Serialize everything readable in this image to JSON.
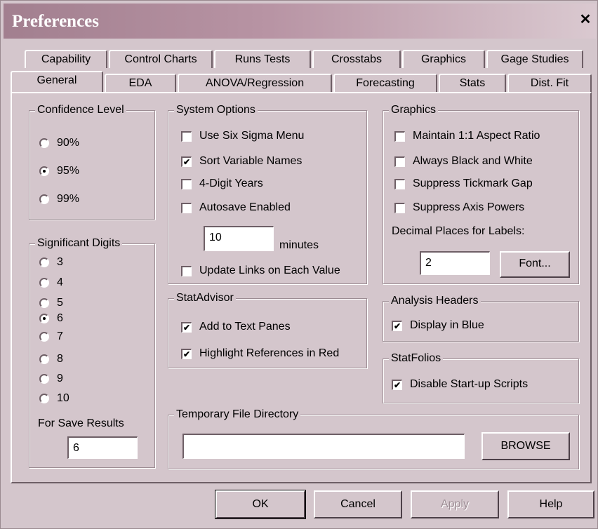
{
  "window": {
    "title": "Preferences"
  },
  "tabs": {
    "row1": [
      "Capability",
      "Control Charts",
      "Runs Tests",
      "Crosstabs",
      "Graphics",
      "Gage Studies"
    ],
    "row2": [
      "General",
      "EDA",
      "ANOVA/Regression",
      "Forecasting",
      "Stats",
      "Dist. Fit"
    ],
    "active": "General"
  },
  "confidence": {
    "title": "Confidence Level",
    "options": [
      "90%",
      "95%",
      "99%"
    ],
    "selected": "95%"
  },
  "significant": {
    "title": "Significant Digits",
    "options": [
      "3",
      "4",
      "5",
      "6",
      "7",
      "8",
      "9",
      "10"
    ],
    "selected": "6",
    "save_label": "For Save Results",
    "save_value": "6"
  },
  "system": {
    "title": "System Options",
    "six_sigma": "Use Six Sigma Menu",
    "sort_vars": "Sort Variable Names",
    "four_digit": "4-Digit Years",
    "autosave": "Autosave Enabled",
    "minutes_value": "10",
    "minutes_label": "minutes",
    "update_links": "Update Links on Each Value"
  },
  "graphics": {
    "title": "Graphics",
    "aspect": "Maintain 1:1 Aspect Ratio",
    "bw": "Always Black and White",
    "tickmark": "Suppress Tickmark Gap",
    "axis_powers": "Suppress Axis Powers",
    "decimal_label": "Decimal Places for Labels:",
    "decimal_value": "2",
    "font_button": "Font..."
  },
  "statadvisor": {
    "title": "StatAdvisor",
    "add_text": "Add to Text Panes",
    "highlight": "Highlight References in Red"
  },
  "analysis_headers": {
    "title": "Analysis Headers",
    "display_blue": "Display in Blue"
  },
  "statfolios": {
    "title": "StatFolios",
    "disable_scripts": "Disable Start-up Scripts"
  },
  "temp_dir": {
    "title": "Temporary File Directory",
    "value": "",
    "browse": "BROWSE"
  },
  "checked": {
    "six_sigma": false,
    "sort_vars": true,
    "four_digit": false,
    "autosave": false,
    "update_links": false,
    "aspect": false,
    "bw": false,
    "tickmark": false,
    "axis_powers": false,
    "add_text": true,
    "highlight": true,
    "display_blue": true,
    "disable_scripts": true
  },
  "footer": {
    "ok": "OK",
    "cancel": "Cancel",
    "apply": "Apply",
    "help": "Help"
  }
}
